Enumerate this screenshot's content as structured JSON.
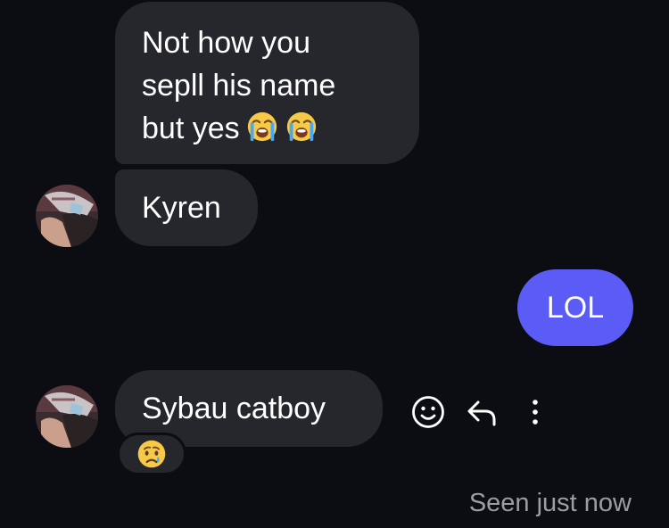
{
  "thread": {
    "messages": [
      {
        "sender": "them",
        "lines": [
          "Not how you",
          "sepll his name",
          "but yes"
        ],
        "emojis": [
          "loudly-crying-face",
          "loudly-crying-face"
        ]
      },
      {
        "sender": "them",
        "text": "Kyren"
      },
      {
        "sender": "me",
        "text": "LOL"
      },
      {
        "sender": "them",
        "text": "Sybau catboy",
        "reaction": "crying-face"
      }
    ],
    "seen_status": "Seen just now"
  },
  "actions": {
    "icons": [
      "smiley-icon",
      "reply-arrow-icon",
      "more-vertical-icon"
    ]
  },
  "colors": {
    "background": "#0c0d12",
    "incoming_bubble": "#26272c",
    "outgoing_bubble": "#5a5cf5",
    "text": "#ffffff",
    "muted": "#9b9da3"
  }
}
